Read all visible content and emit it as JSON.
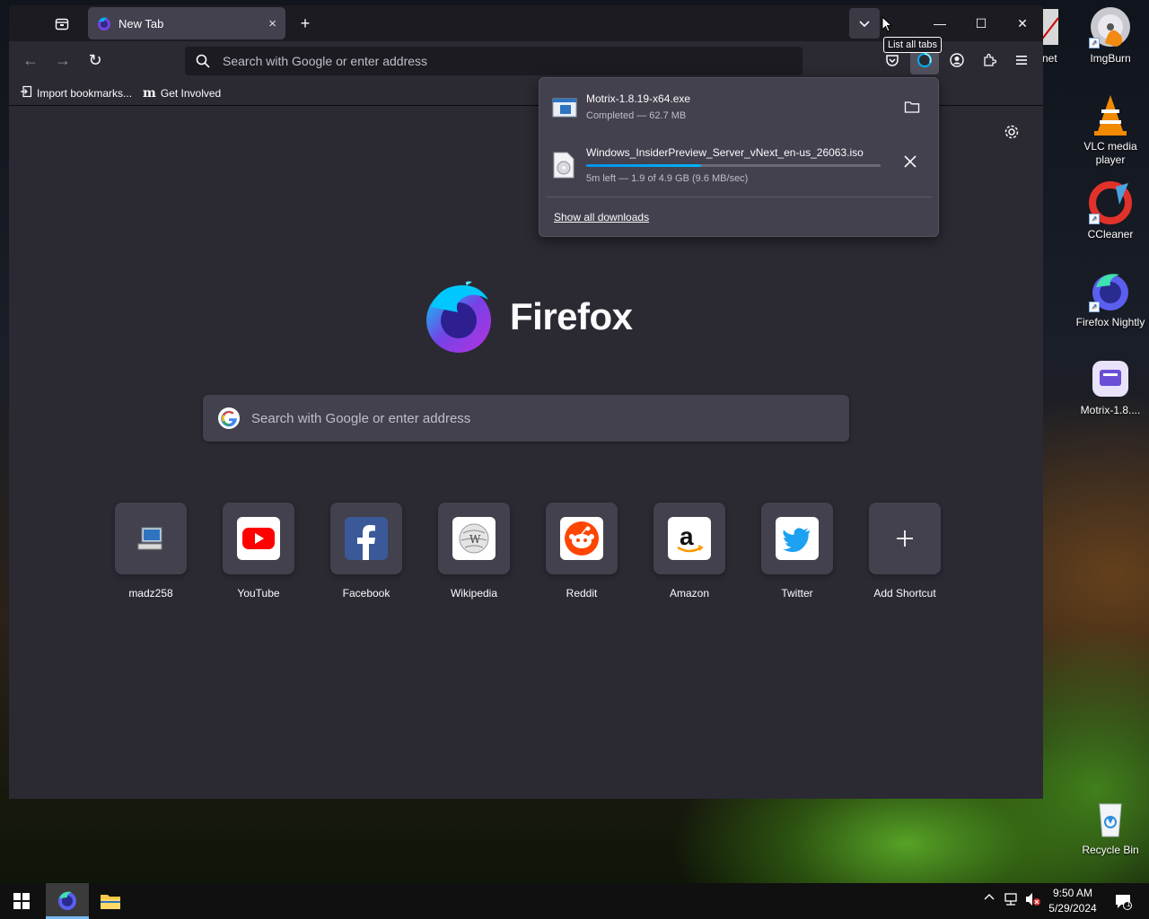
{
  "desktop": {
    "icons": [
      {
        "label": "ImgBurn",
        "icon": "imgburn-icon"
      },
      {
        "label": "VLC media player",
        "icon": "vlc-icon"
      },
      {
        "label": "CCleaner",
        "icon": "ccleaner-icon"
      },
      {
        "label": "Firefox Nightly",
        "icon": "firefox-nightly-icon"
      },
      {
        "label": "Motrix-1.8....",
        "icon": "motrix-icon"
      },
      {
        "label": "Recycle Bin",
        "icon": "recycle-bin-icon"
      }
    ],
    "partial_icon_label": "t.net"
  },
  "browser": {
    "tab": {
      "title": "New Tab",
      "close": "×"
    },
    "new_tab": "+",
    "list_all_tabs_tooltip": "List all tabs",
    "window_controls": {
      "minimize": "—",
      "maximize": "☐",
      "close": "✕"
    },
    "nav": {
      "back": "←",
      "forward": "→",
      "reload": "↻"
    },
    "urlbar_placeholder": "Search with Google or enter address",
    "bookmarks": [
      {
        "label": "Import bookmarks...",
        "icon": "import-icon"
      },
      {
        "label": "Get Involved",
        "icon": "mozilla-icon",
        "glyph": "m"
      }
    ]
  },
  "newtab": {
    "wordmark": "Firefox",
    "search_placeholder": "Search with Google or enter address",
    "shortcuts": [
      {
        "label": "madz258",
        "icon": "computer-icon",
        "color": "#42414d"
      },
      {
        "label": "YouTube",
        "icon": "youtube-icon",
        "color": "#ff0000"
      },
      {
        "label": "Facebook",
        "icon": "facebook-icon",
        "color": "#1877f2"
      },
      {
        "label": "Wikipedia",
        "icon": "wikipedia-icon",
        "color": "#ffffff"
      },
      {
        "label": "Reddit",
        "icon": "reddit-icon",
        "color": "#ff4500"
      },
      {
        "label": "Amazon",
        "icon": "amazon-icon",
        "color": "#ffffff"
      },
      {
        "label": "Twitter",
        "icon": "twitter-icon",
        "color": "#1da1f2"
      },
      {
        "label": "Add Shortcut",
        "icon": "plus-icon",
        "color": "#42414d"
      }
    ]
  },
  "downloads": {
    "items": [
      {
        "name": "Motrix-1.8.19-x64.exe",
        "status": "Completed — 62.7 MB",
        "action": "open-folder"
      },
      {
        "name": "Windows_InsiderPreview_Server_vNext_en-us_26063.iso",
        "status": "5m left — 1.9 of 4.9 GB (9.6 MB/sec)",
        "progress": 0.39,
        "action": "cancel"
      }
    ],
    "show_all": "Show all downloads"
  },
  "taskbar": {
    "time": "9:50 AM",
    "date": "5/29/2024",
    "notification_count": "1"
  }
}
